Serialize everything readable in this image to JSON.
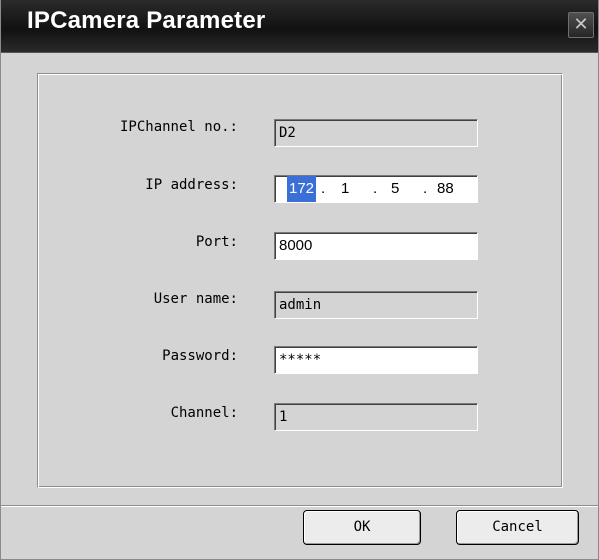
{
  "dialog": {
    "title": "IPCamera Parameter",
    "close_glyph": "✕"
  },
  "form": {
    "ipchannel": {
      "label": "IPChannel no.:",
      "value": "D2"
    },
    "ip_address": {
      "label": "IP address:",
      "octets": [
        "172",
        "1",
        "5",
        "88"
      ],
      "dot": "."
    },
    "port": {
      "label": "Port:",
      "value": "8000"
    },
    "user_name": {
      "label": "User name:",
      "value": "admin"
    },
    "password": {
      "label": "Password:",
      "value": "*****"
    },
    "channel": {
      "label": "Channel:",
      "value": "1"
    }
  },
  "buttons": {
    "ok_label": "OK",
    "cancel_label": "Cancel"
  },
  "colors": {
    "titlebar": "#111111",
    "dialog_bg": "#d4d4d4",
    "selection": "#3a6fd8"
  }
}
